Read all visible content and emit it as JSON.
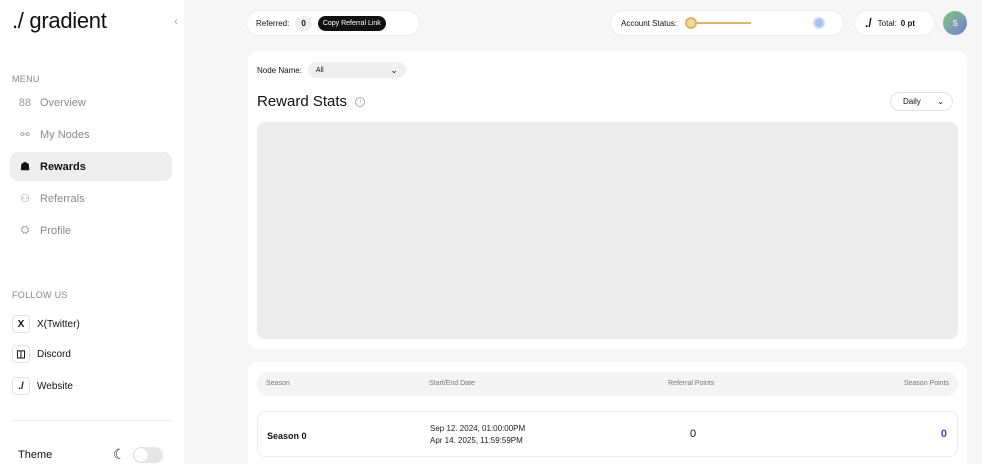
{
  "brand": {
    "logo": "./ gradient",
    "collapse_icon": "‹"
  },
  "sidebar": {
    "menu_label": "MENU",
    "items": [
      {
        "label": "Overview",
        "icon": "88"
      },
      {
        "label": "My Nodes",
        "icon": "⚯"
      },
      {
        "label": "Rewards",
        "icon": "☗"
      },
      {
        "label": "Referrals",
        "icon": "⚇"
      },
      {
        "label": "Profile",
        "icon": "⛭"
      }
    ],
    "follow_label": "FOLLOW US",
    "follow": [
      {
        "label": "X(Twitter)",
        "icon": "X"
      },
      {
        "label": "Discord",
        "icon": "◫"
      },
      {
        "label": "Website",
        "icon": "./"
      }
    ],
    "theme_label": "Theme",
    "moon_icon": "☾"
  },
  "topbar": {
    "referred_label": "Referred:",
    "referred_count": "0",
    "copy_button": "Copy Referral Link",
    "status_label": "Account Status:",
    "total_slash": "./",
    "total_label": "Total:",
    "total_value": "0 pt",
    "avatar_letter": "S"
  },
  "stats": {
    "node_label": "Node Name:",
    "node_value": "All",
    "title": "Reward Stats",
    "period": "Daily",
    "chevron": "⌄"
  },
  "seasons": {
    "headers": [
      "Season",
      "Start/End Date",
      "Referral Points",
      "Season Points"
    ],
    "rows": [
      {
        "season": "Season 0",
        "start": "Sep 12. 2024, 01:00:00PM",
        "end": "Apr 14. 2025, 11:59:59PM",
        "referral_points": "0",
        "season_points": "0"
      }
    ]
  },
  "colors": {
    "accent": "#4a48c9",
    "status_gold": "#d9b56b",
    "active_bg": "#eeeeee"
  }
}
